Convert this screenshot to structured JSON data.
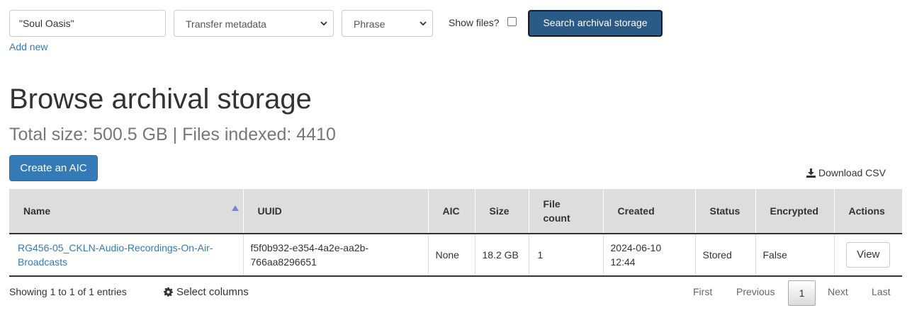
{
  "search": {
    "query_value": "\"Soul Oasis\"",
    "field_select": "Transfer metadata",
    "type_select": "Phrase",
    "show_files_label": "Show files?",
    "show_files_checked": false,
    "search_button": "Search archival storage",
    "add_new_link": "Add new"
  },
  "page": {
    "title": "Browse archival storage",
    "subtitle": "Total size: 500.5 GB | Files indexed: 4410",
    "create_aic_button": "Create an AIC",
    "download_csv": "Download CSV"
  },
  "table": {
    "columns": {
      "name": "Name",
      "uuid": "UUID",
      "aic": "AIC",
      "size": "Size",
      "file_count": "File count",
      "created": "Created",
      "status": "Status",
      "encrypted": "Encrypted",
      "actions": "Actions"
    },
    "rows": [
      {
        "name": "RG456-05_CKLN-Audio-Recordings-On-Air-Broadcasts",
        "uuid": "f5f0b932-e354-4a2e-aa2b-766aa8296651",
        "aic": "None",
        "size": "18.2 GB",
        "file_count": "1",
        "created": "2024-06-10 12:44",
        "status": "Stored",
        "encrypted": "False",
        "action": "View"
      }
    ]
  },
  "footer": {
    "info": "Showing 1 to 1 of 1 entries",
    "select_columns": "Select columns",
    "pagination": {
      "first": "First",
      "previous": "Previous",
      "current": "1",
      "next": "Next",
      "last": "Last"
    }
  },
  "colors": {
    "primary": "#337ab7",
    "search_button": "#2a5a86",
    "header_bg": "#dddddd",
    "subtitle": "#777777"
  },
  "icons": [
    "chevron-down-icon",
    "sort-asc-icon",
    "download-icon",
    "gear-icon"
  ]
}
